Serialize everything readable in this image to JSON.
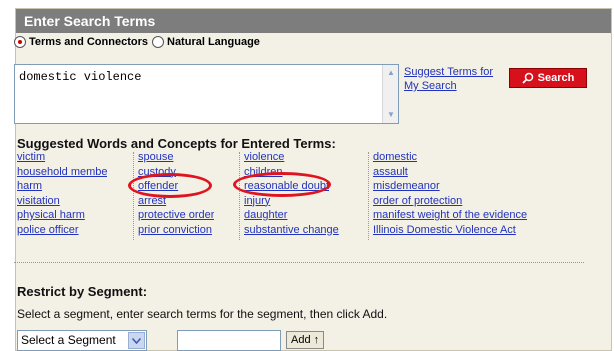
{
  "header": {
    "title": "Enter Search Terms"
  },
  "mode": {
    "options": [
      {
        "label": "Terms and Connectors",
        "checked": true
      },
      {
        "label": "Natural Language",
        "checked": false
      }
    ]
  },
  "search": {
    "value": "domestic violence",
    "suggest_link": "Suggest Terms for My Search",
    "button_label": "Search"
  },
  "suggested": {
    "title": "Suggested Words and Concepts for Entered Terms:",
    "columns": [
      [
        "victim",
        "household membe",
        "harm",
        "visitation",
        "physical harm",
        "police officer"
      ],
      [
        "spouse",
        "custody",
        "offender",
        "arrest",
        "protective order",
        "prior conviction"
      ],
      [
        "violence",
        "children",
        "reasonable doubt",
        "injury",
        "daughter",
        "substantive change"
      ],
      [
        "domestic",
        "assault",
        "misdemeanor",
        "order of protection",
        "manifest weight of the evidence",
        "Illinois Domestic Violence Act"
      ]
    ]
  },
  "restrict": {
    "title": "Restrict by Segment:",
    "description": "Select a segment, enter search terms for the segment, then click Add.",
    "select_value": "Select a Segment",
    "add_label": "Add"
  },
  "colors": {
    "header": "#7d7d7d",
    "accent": "#d6111b",
    "link": "#2233bb",
    "annotation": "#e0141e",
    "panel": "#f3f0e6"
  }
}
